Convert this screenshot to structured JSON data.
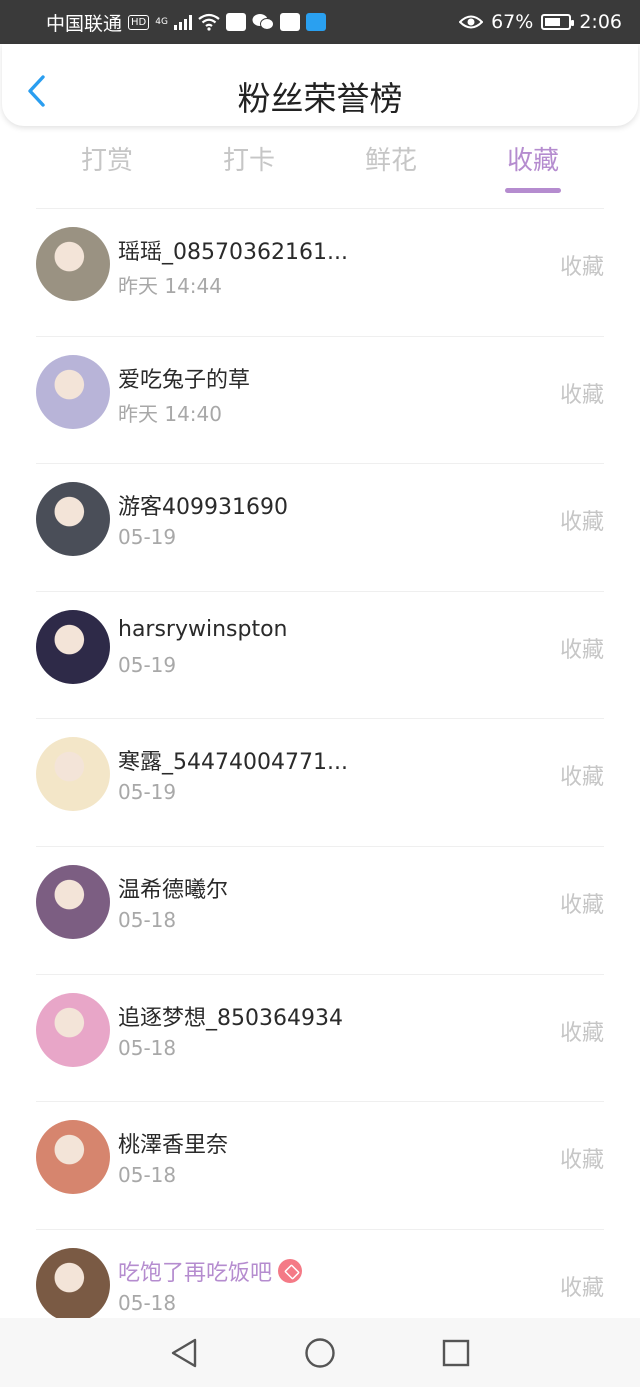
{
  "status_bar": {
    "carrier": "中国联通",
    "hd_label": "HD",
    "network_label": "4G",
    "battery_percent": "67%",
    "battery_level": 0.67,
    "time": "2:06"
  },
  "header": {
    "title": "粉丝荣誉榜"
  },
  "tabs": [
    {
      "label": "打赏",
      "active": false
    },
    {
      "label": "打卡",
      "active": false
    },
    {
      "label": "鲜花",
      "active": false
    },
    {
      "label": "收藏",
      "active": true
    }
  ],
  "list": [
    {
      "name": "瑶瑶_08570362161...",
      "time": "昨天 14:44",
      "action": "收藏",
      "avatar_color": "#9a9282"
    },
    {
      "name": "爱吃兔子的草",
      "time": "昨天 14:40",
      "action": "收藏",
      "avatar_color": "#b8b4d8"
    },
    {
      "name": "游客409931690",
      "time": "05-19",
      "action": "收藏",
      "avatar_color": "#4a4e58"
    },
    {
      "name": "harsrywinspton",
      "time": "05-19",
      "action": "收藏",
      "avatar_color": "#2e2a48"
    },
    {
      "name": "寒露_54474004771...",
      "time": "05-19",
      "action": "收藏",
      "avatar_color": "#f3e6c8"
    },
    {
      "name": "温希德曦尔",
      "time": "05-18",
      "action": "收藏",
      "avatar_color": "#7c5e82"
    },
    {
      "name": "追逐梦想_850364934",
      "time": "05-18",
      "action": "收藏",
      "avatar_color": "#e8a6c8"
    },
    {
      "name": "桃澤香里奈",
      "time": "05-18",
      "action": "收藏",
      "avatar_color": "#d6856e"
    },
    {
      "name": "吃饱了再吃饭吧",
      "time": "05-18",
      "action": "收藏",
      "avatar_color": "#7a5a44",
      "vip": true
    }
  ],
  "colors": {
    "accent": "#b58ccf",
    "inactive_text": "#c6c6c6",
    "back_icon": "#2a9ef0"
  }
}
